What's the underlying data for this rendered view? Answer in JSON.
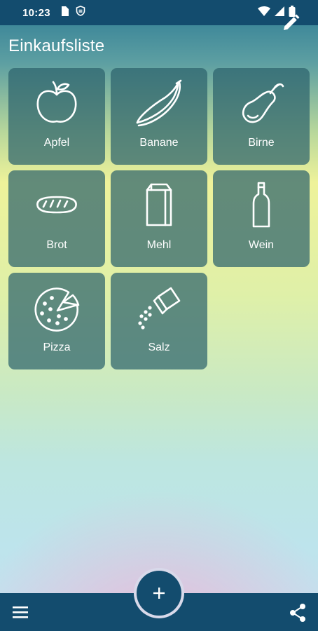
{
  "status_bar": {
    "time": "10:23",
    "icons": [
      "sim-card-icon",
      "shield-icon",
      "wifi-icon",
      "signal-icon",
      "battery-icon"
    ]
  },
  "header": {
    "title": "Einkaufsliste",
    "edit_icon": "pencil-icon"
  },
  "items": [
    {
      "label": "Apfel",
      "icon": "apple-icon"
    },
    {
      "label": "Banane",
      "icon": "banana-icon"
    },
    {
      "label": "Birne",
      "icon": "pear-icon"
    },
    {
      "label": "Brot",
      "icon": "bread-icon"
    },
    {
      "label": "Mehl",
      "icon": "flour-bag-icon"
    },
    {
      "label": "Wein",
      "icon": "wine-bottle-icon"
    },
    {
      "label": "Pizza",
      "icon": "pizza-icon"
    },
    {
      "label": "Salz",
      "icon": "salt-shaker-icon"
    }
  ],
  "bottom_bar": {
    "menu_icon": "menu-icon",
    "add_icon": "plus-icon",
    "share_icon": "share-icon"
  },
  "colors": {
    "bar": "#134c6e",
    "tile": "#2c626c",
    "text": "#ffffff"
  }
}
